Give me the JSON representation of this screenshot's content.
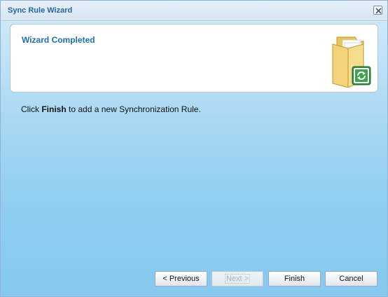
{
  "window": {
    "title": "Sync Rule Wizard"
  },
  "header": {
    "title": "Wizard Completed",
    "icon": "folder-sync-icon"
  },
  "instruction": {
    "prefix": "Click ",
    "emphasis": "Finish",
    "suffix": " to add a new Synchronization Rule."
  },
  "buttons": {
    "previous": "< Previous",
    "next": "Next >",
    "finish": "Finish",
    "cancel": "Cancel"
  },
  "colors": {
    "title_text": "#2266aa",
    "header_title": "#1f6fb0",
    "sync_badge": "#2e8b3a"
  }
}
